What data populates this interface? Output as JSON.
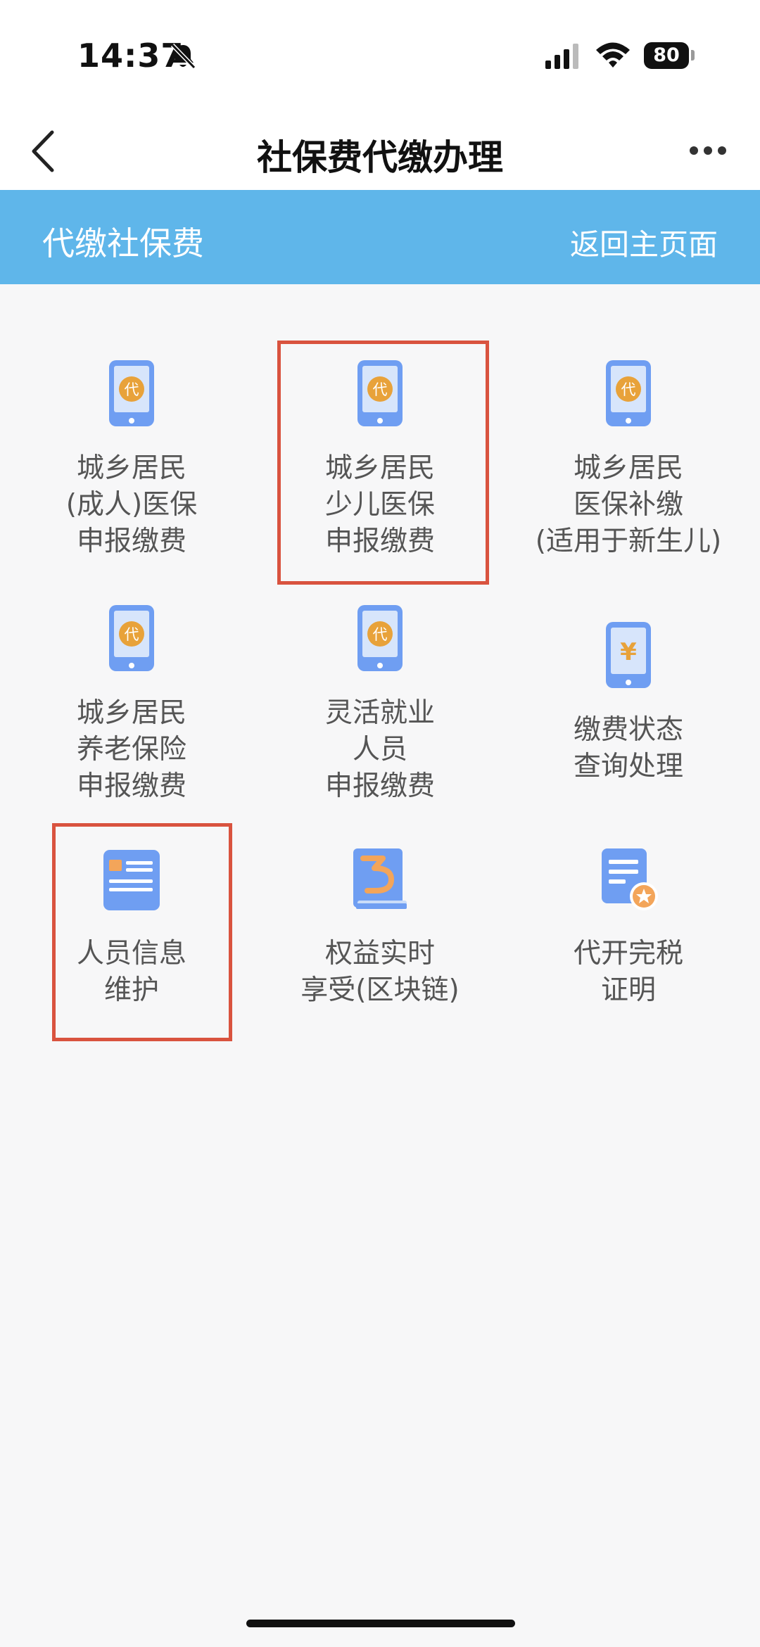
{
  "status_bar": {
    "time": "14:37",
    "battery": "80"
  },
  "nav": {
    "title": "社保费代缴办理"
  },
  "banner": {
    "title": "代缴社保费",
    "link": "返回主页面"
  },
  "icons": {
    "dai_badge": "代",
    "yuan_sign": "¥"
  },
  "colors": {
    "banner": "#5fb6ea",
    "icon_blue": "#6f9ef2",
    "icon_badge": "#e8a23a",
    "highlight": "#d9533f"
  },
  "grid": [
    {
      "icon": "phone-dai-icon",
      "lines": [
        "城乡居民",
        "(成人)医保",
        "申报缴费"
      ]
    },
    {
      "icon": "phone-dai-icon",
      "lines": [
        "城乡居民",
        "少儿医保",
        "申报缴费"
      ]
    },
    {
      "icon": "phone-dai-icon",
      "lines": [
        "城乡居民",
        "医保补缴",
        "(适用于新生儿)"
      ]
    },
    {
      "icon": "phone-dai-icon",
      "lines": [
        "城乡居民",
        "养老保险",
        "申报缴费"
      ]
    },
    {
      "icon": "phone-dai-icon",
      "lines": [
        "灵活就业",
        "人员",
        "申报缴费"
      ]
    },
    {
      "icon": "phone-yuan-icon",
      "lines": [
        "缴费状态",
        "查询处理"
      ]
    },
    {
      "icon": "id-card-icon",
      "lines": [
        "人员信息",
        "维护"
      ]
    },
    {
      "icon": "book-icon",
      "lines": [
        "权益实时",
        "享受(区块链)"
      ]
    },
    {
      "icon": "certificate-icon",
      "lines": [
        "代开完税",
        "证明"
      ]
    }
  ]
}
